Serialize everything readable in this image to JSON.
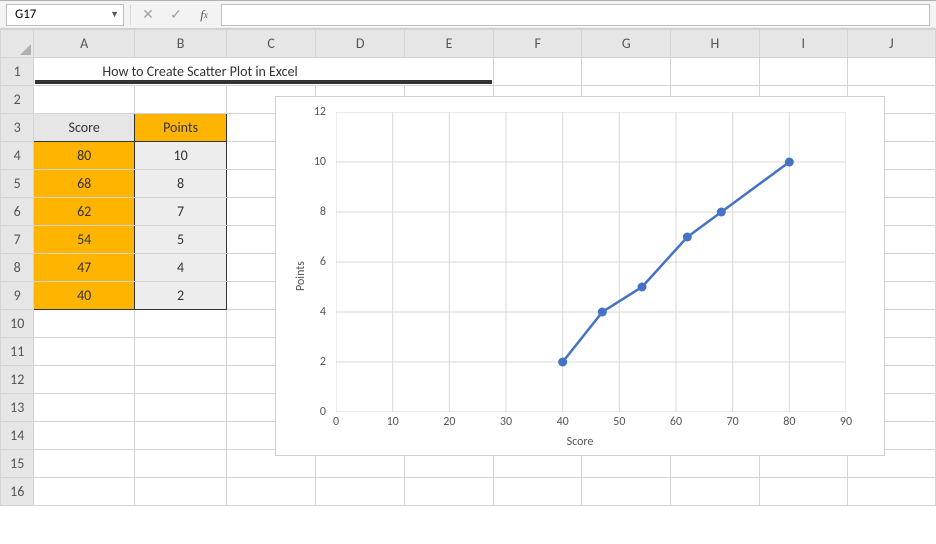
{
  "formula_bar": {
    "name_box": "G17",
    "fx_label": "fx",
    "formula_value": ""
  },
  "columns": [
    "A",
    "B",
    "C",
    "D",
    "E",
    "F",
    "G",
    "H",
    "I",
    "J"
  ],
  "rows": [
    "1",
    "2",
    "3",
    "4",
    "5",
    "6",
    "7",
    "8",
    "9",
    "10",
    "11",
    "12",
    "13",
    "14",
    "15",
    "16"
  ],
  "title": "How to Create Scatter Plot in Excel",
  "table": {
    "headers": {
      "score": "Score",
      "points": "Points"
    },
    "rows": [
      {
        "score": "80",
        "points": "10"
      },
      {
        "score": "68",
        "points": "8"
      },
      {
        "score": "62",
        "points": "7"
      },
      {
        "score": "54",
        "points": "5"
      },
      {
        "score": "47",
        "points": "4"
      },
      {
        "score": "40",
        "points": "2"
      }
    ]
  },
  "chart_data": {
    "type": "scatter",
    "title": "",
    "xlabel": "Score",
    "ylabel": "Points",
    "xlim": [
      0,
      90
    ],
    "ylim": [
      0,
      12
    ],
    "xticks": [
      0,
      10,
      20,
      30,
      40,
      50,
      60,
      70,
      80,
      90
    ],
    "yticks": [
      0,
      2,
      4,
      6,
      8,
      10,
      12
    ],
    "series": [
      {
        "name": "Points",
        "color": "#4472c4",
        "x": [
          40,
          47,
          54,
          62,
          68,
          80
        ],
        "y": [
          2,
          4,
          5,
          7,
          8,
          10
        ]
      }
    ]
  }
}
